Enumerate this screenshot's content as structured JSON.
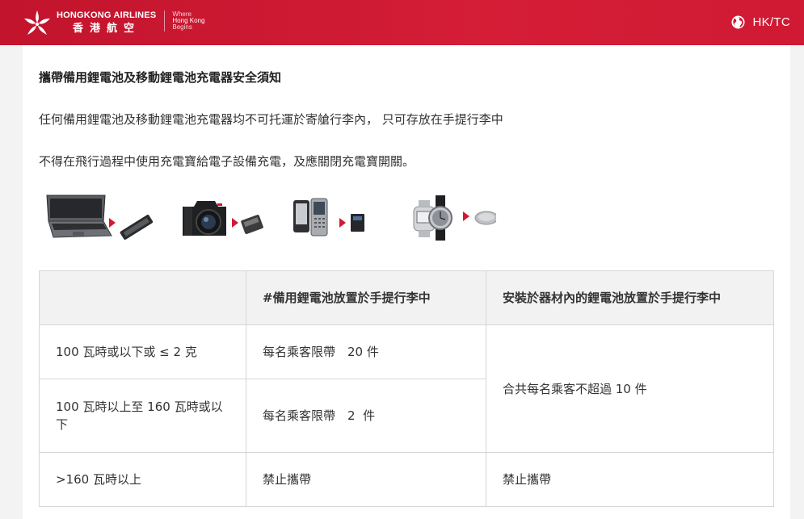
{
  "header": {
    "brand_en": "HONGKONG AIRLINES",
    "brand_zh": "香港航空",
    "slogan": [
      "Where",
      "Hong Kong",
      "Begins"
    ],
    "logo_icon": "bauhinia-logo-icon",
    "language_icon": "globe-icon",
    "language_label": "HK/TC",
    "colors": {
      "bar": "#d01a33",
      "text": "#ffffff"
    }
  },
  "notice": {
    "title": "攜帶備用鋰電池及移動鋰電池充電器安全須知",
    "paragraph1": "任何備用鋰電池及移動鋰電池充電器均不可托運於寄艙行李內， 只可存放在手提行李中",
    "paragraph2": "不得在飛行過程中使用充電寶給電子設備充電，及應關閉充電寶開關。"
  },
  "illustration": {
    "items": [
      {
        "device": "laptop-icon",
        "battery": "laptop-battery-icon"
      },
      {
        "device": "camera-icon",
        "battery": "camera-battery-icon"
      },
      {
        "device": "mobile-phone-icon",
        "battery": "phone-battery-icon"
      },
      {
        "device": "watch-icon",
        "battery": "coin-cell-battery-icon"
      }
    ],
    "arrow_color": "#d01a33"
  },
  "table": {
    "headers": [
      "",
      "#備用鋰電池放置於手提行李中",
      "安裝於器材內的鋰電池放置於手提行李中"
    ],
    "rows": [
      {
        "label": "100 瓦時或以下或 ≤ 2 克",
        "spare": "每名乘客限帶　20 件"
      },
      {
        "label": "100 瓦時以上至 160 瓦時或以下",
        "spare": "每名乘客限帶　2  件"
      },
      {
        "label": ">160 瓦時以上",
        "spare": "禁止攜帶",
        "installed": "禁止攜帶"
      }
    ],
    "installed_merged": "合共每名乘客不超過 10 件"
  }
}
